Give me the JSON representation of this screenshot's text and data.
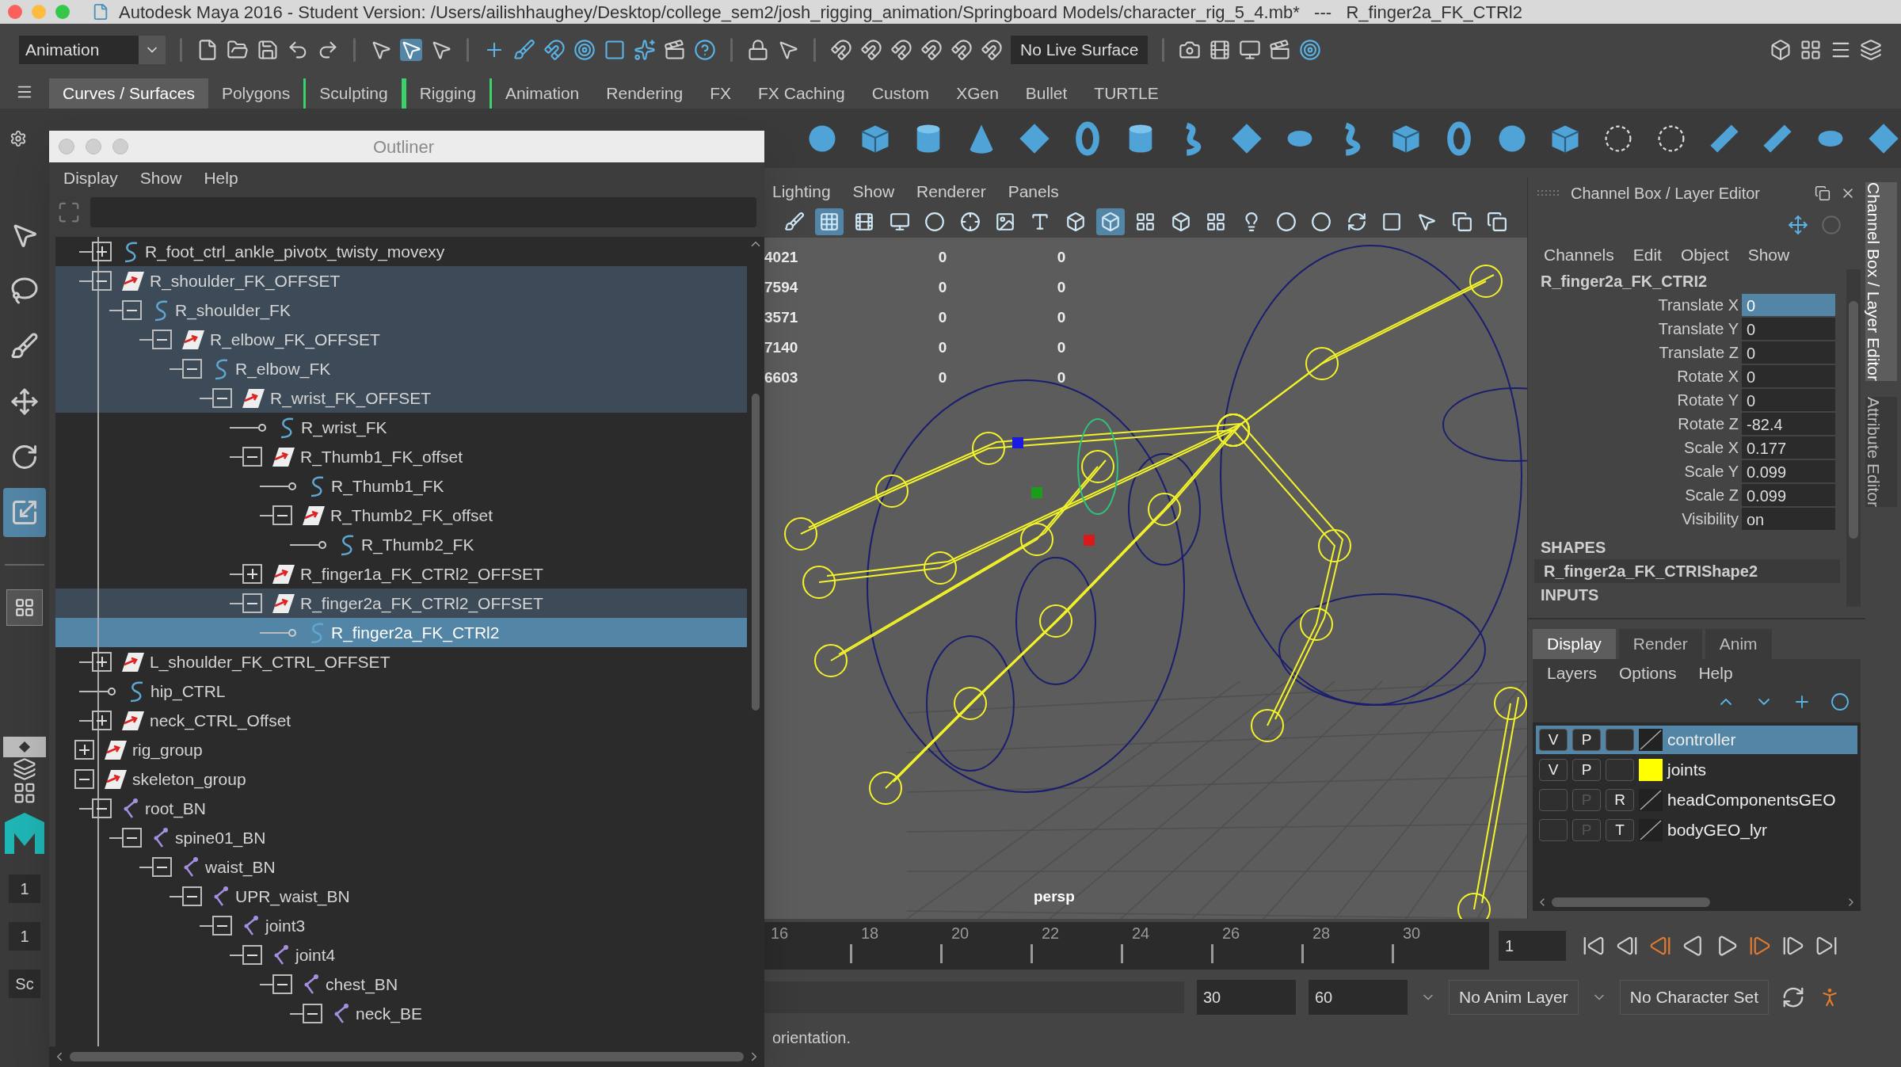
{
  "window": {
    "title": "Autodesk Maya 2016 - Student Version: /Users/ailishhaughey/Desktop/college_sem2/josh_rigging_animation/Springboard Models/character_rig_5_4.mb*   ---   R_finger2a_FK_CTRl2"
  },
  "toolbar": {
    "menu_set": "Animation",
    "live_surface": "No Live Surface"
  },
  "shelf_tabs": [
    {
      "label": "Curves / Surfaces",
      "selected": true,
      "bracketed": false
    },
    {
      "label": "Polygons",
      "selected": false,
      "bracketed": false
    },
    {
      "label": "Sculpting",
      "selected": false,
      "bracketed": true
    },
    {
      "label": "Rigging",
      "selected": false,
      "bracketed": true
    },
    {
      "label": "Animation",
      "selected": false,
      "bracketed": false
    },
    {
      "label": "Rendering",
      "selected": false,
      "bracketed": false
    },
    {
      "label": "FX",
      "selected": false,
      "bracketed": false
    },
    {
      "label": "FX Caching",
      "selected": false,
      "bracketed": false
    },
    {
      "label": "Custom",
      "selected": false,
      "bracketed": false
    },
    {
      "label": "XGen",
      "selected": false,
      "bracketed": false
    },
    {
      "label": "Bullet",
      "selected": false,
      "bracketed": false
    },
    {
      "label": "TURTLE",
      "selected": false,
      "bracketed": false
    }
  ],
  "tools": [
    {
      "kind": "select",
      "selected": false
    },
    {
      "kind": "lasso",
      "selected": false
    },
    {
      "kind": "paint",
      "selected": false
    },
    {
      "kind": "move",
      "selected": false
    },
    {
      "kind": "rotate",
      "selected": false
    },
    {
      "kind": "scale",
      "selected": true
    }
  ],
  "left_fields": [
    "1",
    "1",
    "Sc"
  ],
  "outliner": {
    "title": "Outliner",
    "menu": [
      "Display",
      "Show",
      "Help"
    ],
    "continued_branch": [
      {
        "label": "R_foot_ctrl_ankle_pivotx_twisty_movexy",
        "kind": "curve",
        "expanded": false,
        "selected": false,
        "highlighted": false
      },
      {
        "label": "R_shoulder_FK_OFFSET",
        "kind": "group",
        "expanded": true,
        "selected": false,
        "highlighted": true,
        "children": [
          {
            "label": "R_shoulder_FK",
            "kind": "curve",
            "expanded": true,
            "selected": false,
            "highlighted": true,
            "children": [
              {
                "label": "R_elbow_FK_OFFSET",
                "kind": "group",
                "expanded": true,
                "selected": false,
                "highlighted": true,
                "children": [
                  {
                    "label": "R_elbow_FK",
                    "kind": "curve",
                    "expanded": true,
                    "selected": false,
                    "highlighted": true,
                    "children": [
                      {
                        "label": "R_wrist_FK_OFFSET",
                        "kind": "group",
                        "expanded": true,
                        "selected": false,
                        "highlighted": true,
                        "children": [
                          {
                            "label": "R_wrist_FK",
                            "kind": "curve",
                            "selected": false,
                            "highlighted": false
                          },
                          {
                            "label": "R_Thumb1_FK_offset",
                            "kind": "group",
                            "expanded": true,
                            "selected": false,
                            "highlighted": false,
                            "children": [
                              {
                                "label": "R_Thumb1_FK",
                                "kind": "curve",
                                "selected": false,
                                "highlighted": false
                              },
                              {
                                "label": "R_Thumb2_FK_offset",
                                "kind": "group",
                                "expanded": true,
                                "selected": false,
                                "highlighted": false,
                                "children": [
                                  {
                                    "label": "R_Thumb2_FK",
                                    "kind": "curve",
                                    "selected": false,
                                    "highlighted": false
                                  }
                                ]
                              }
                            ]
                          },
                          {
                            "label": "R_finger1a_FK_CTRl2_OFFSET",
                            "kind": "group",
                            "expanded": false,
                            "selected": false,
                            "highlighted": false
                          },
                          {
                            "label": "R_finger2a_FK_CTRl2_OFFSET",
                            "kind": "group",
                            "expanded": true,
                            "selected": false,
                            "highlighted": true,
                            "children": [
                              {
                                "label": "R_finger2a_FK_CTRl2",
                                "kind": "curve",
                                "selected": true
                              }
                            ]
                          }
                        ]
                      }
                    ]
                  }
                ]
              }
            ]
          }
        ]
      },
      {
        "label": "L_shoulder_FK_CTRL_OFFSET",
        "kind": "group",
        "expanded": false,
        "selected": false,
        "highlighted": false
      },
      {
        "label": "hip_CTRL",
        "kind": "curve",
        "selected": false,
        "highlighted": false
      },
      {
        "label": "neck_CTRL_Offset",
        "kind": "group",
        "expanded": false,
        "selected": false,
        "highlighted": false
      }
    ],
    "tree": [
      {
        "label": "rig_group",
        "kind": "group",
        "expanded": false,
        "selected": false,
        "highlighted": false
      },
      {
        "label": "skeleton_group",
        "kind": "group",
        "expanded": true,
        "selected": false,
        "highlighted": false,
        "children": [
          {
            "label": "root_BN",
            "kind": "joint",
            "expanded": true,
            "selected": false,
            "highlighted": false,
            "children": [
              {
                "label": "spine01_BN",
                "kind": "joint",
                "expanded": true,
                "selected": false,
                "highlighted": false,
                "children": [
                  {
                    "label": "waist_BN",
                    "kind": "joint",
                    "expanded": true,
                    "selected": false,
                    "highlighted": false,
                    "children": [
                      {
                        "label": "UPR_waist_BN",
                        "kind": "joint",
                        "expanded": true,
                        "selected": false,
                        "highlighted": false,
                        "children": [
                          {
                            "label": "joint3",
                            "kind": "joint",
                            "expanded": true,
                            "selected": false,
                            "highlighted": false,
                            "children": [
                              {
                                "label": "joint4",
                                "kind": "joint",
                                "expanded": true,
                                "selected": false,
                                "highlighted": false,
                                "children": [
                                  {
                                    "label": "chest_BN",
                                    "kind": "joint",
                                    "expanded": true,
                                    "selected": false,
                                    "highlighted": false,
                                    "children": [
                                      {
                                        "label": "neck_BE",
                                        "kind": "joint",
                                        "expanded": true,
                                        "selected": false,
                                        "highlighted": false
                                      }
                                    ]
                                  }
                                ]
                              }
                            ]
                          }
                        ]
                      }
                    ]
                  }
                ]
              }
            ]
          }
        ]
      }
    ]
  },
  "viewport": {
    "menu": [
      "Lighting",
      "Show",
      "Renderer",
      "Panels"
    ],
    "toolbar": [
      {
        "kind": "paint",
        "on": false
      },
      {
        "kind": "grid",
        "on": true
      },
      {
        "kind": "film",
        "on": false
      },
      {
        "kind": "gate",
        "on": false
      },
      {
        "kind": "dot",
        "on": false
      },
      {
        "kind": "fit",
        "on": false
      },
      {
        "kind": "image",
        "on": false
      },
      {
        "kind": "text",
        "on": false
      },
      {
        "kind": "wire",
        "on": false
      },
      {
        "kind": "solid",
        "on": true
      },
      {
        "kind": "checker",
        "on": false
      },
      {
        "kind": "box",
        "on": false
      },
      {
        "kind": "checker",
        "on": false
      },
      {
        "kind": "light",
        "on": false
      },
      {
        "kind": "dot",
        "on": false
      },
      {
        "kind": "dot",
        "on": false
      },
      {
        "kind": "ring",
        "on": false
      },
      {
        "kind": "square",
        "on": false
      },
      {
        "kind": "select",
        "on": false
      },
      {
        "kind": "copy",
        "on": false
      },
      {
        "kind": "copy",
        "on": false
      }
    ],
    "hud": [
      [
        "4021",
        "0",
        "0"
      ],
      [
        "7594",
        "0",
        "0"
      ],
      [
        "3571",
        "0",
        "0"
      ],
      [
        "7140",
        "0",
        "0"
      ],
      [
        "6603",
        "0",
        "0"
      ]
    ],
    "camera": "persp"
  },
  "channel_box": {
    "title": "Channel Box / Layer Editor",
    "menu": [
      "Channels",
      "Edit",
      "Object",
      "Show"
    ],
    "object": "R_finger2a_FK_CTRI2",
    "attributes": [
      {
        "label": "Translate X",
        "value": "0",
        "selected": true
      },
      {
        "label": "Translate Y",
        "value": "0",
        "selected": false
      },
      {
        "label": "Translate Z",
        "value": "0",
        "selected": false
      },
      {
        "label": "Rotate X",
        "value": "0",
        "selected": false
      },
      {
        "label": "Rotate Y",
        "value": "0",
        "selected": false
      },
      {
        "label": "Rotate Z",
        "value": "-82.4",
        "selected": false
      },
      {
        "label": "Scale X",
        "value": "0.177",
        "selected": false
      },
      {
        "label": "Scale Y",
        "value": "0.099",
        "selected": false
      },
      {
        "label": "Scale Z",
        "value": "0.099",
        "selected": false
      },
      {
        "label": "Visibility",
        "value": "on",
        "selected": false
      }
    ],
    "shapes_heading": "SHAPES",
    "shape": "R_finger2a_FK_CTRIShape2",
    "inputs_heading": "INPUTS"
  },
  "layer_editor": {
    "tabs": [
      {
        "label": "Display",
        "selected": true
      },
      {
        "label": "Render",
        "selected": false
      },
      {
        "label": "Anim",
        "selected": false
      }
    ],
    "menu": [
      "Layers",
      "Options",
      "Help"
    ],
    "layers": [
      {
        "name": "controller",
        "v": "V",
        "p": "P",
        "p_enabled": true,
        "selected": true
      },
      {
        "name": "joints",
        "v": "V",
        "p": "P",
        "p_enabled": true,
        "color": "#ffff00",
        "selected": false
      },
      {
        "name": "headComponentsGEO",
        "p": "P",
        "p_enabled": false,
        "mode": "R",
        "selected": false
      },
      {
        "name": "bodyGEO_lyr",
        "p": "P",
        "p_enabled": false,
        "mode": "T",
        "selected": false
      }
    ]
  },
  "side_tabs": [
    {
      "label": "Channel Box / Layer Editor",
      "selected": true
    },
    {
      "label": "Attribute Editor",
      "selected": false
    }
  ],
  "timeline": {
    "ticks": [
      "16",
      "18",
      "20",
      "22",
      "24",
      "26",
      "28",
      "30"
    ],
    "current_frame": "1"
  },
  "range": {
    "start": "30",
    "end": "60",
    "anim_layer": "No Anim Layer",
    "character_set": "No Character Set"
  },
  "help_line": "orientation."
}
